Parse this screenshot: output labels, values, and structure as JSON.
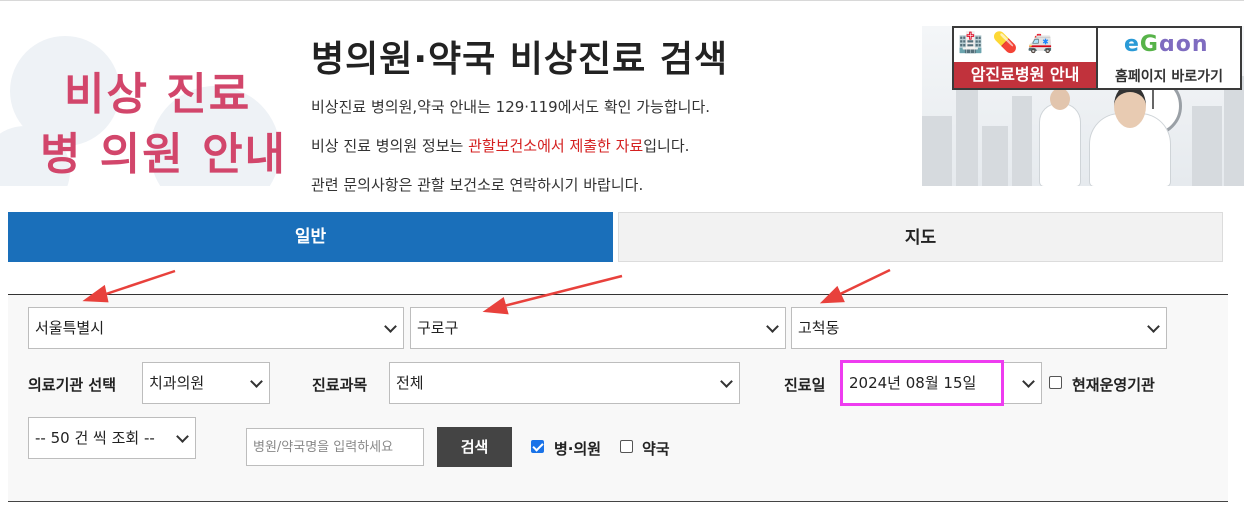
{
  "header": {
    "banner_line1": "비상 진료",
    "banner_line2": "병 의원 안내",
    "title": "병의원·약국 비상진료 검색",
    "info1": "비상진료 병의원,약국 안내는 129·119에서도 확인 가능합니다.",
    "info2_before": "비상 진료 병의원 정보는 ",
    "info2_red": "관할보건소에서 제출한 자료",
    "info2_after": "입니다.",
    "info3": "관련 문의사항은 관할 보건소로 연락하시기 바랍니다.",
    "cancer_icons": "🏥💊🚑",
    "cancer_label": "암진료병원 안내",
    "home_logo_a": "e",
    "home_logo_b": "G",
    "home_logo_c": "ɑon",
    "home_label": "홈페이지 바로가기"
  },
  "tabs": {
    "general": "일반",
    "map": "지도"
  },
  "filters": {
    "city": "서울특별시",
    "district": "구로구",
    "dong": "고척동",
    "institution_label": "의료기관 선택",
    "institution_value": "치과의원",
    "department_label": "진료과목",
    "department_value": "전체",
    "date_label": "진료일",
    "date_value": "2024년 08월 15일",
    "operating_label": "현재운영기관",
    "page_size": "-- 50 건 씩 조회 --",
    "search_placeholder": "병원/약국명을 입력하세요",
    "search_button": "검색",
    "hospital_label": "병·의원",
    "pharmacy_label": "약국"
  },
  "colors": {
    "tab_active": "#1a6fba",
    "annotation_arrow": "#e8413c",
    "date_highlight": "#ee3cf0",
    "banner_text": "#d2466b",
    "notice_red": "#d42020"
  }
}
